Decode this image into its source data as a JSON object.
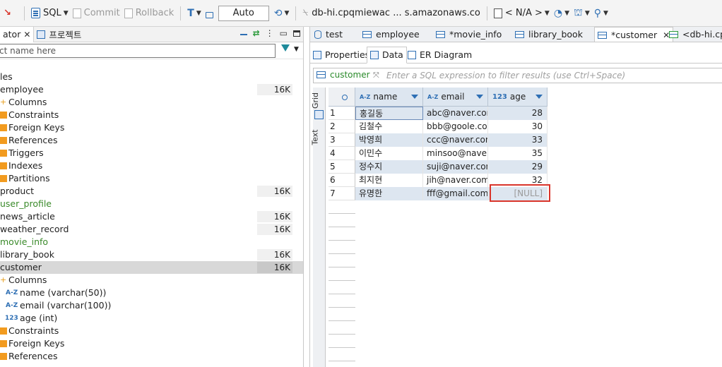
{
  "toolbar": {
    "sql_label": "SQL",
    "commit_label": "Commit",
    "rollback_label": "Rollback",
    "tx_mode": "Auto",
    "connection": "db-hi.cpqmiewac ... s.amazonaws.co",
    "schema": "< N/A >"
  },
  "left_panel": {
    "tab_navigator": "ator",
    "tab_project": "프로젝트",
    "filter_placeholder": "ct name here"
  },
  "tree": [
    {
      "label": "les",
      "indent": 0,
      "icon": "",
      "size": ""
    },
    {
      "label": "employee",
      "indent": 0,
      "icon": "",
      "size": "16K"
    },
    {
      "label": "Columns",
      "indent": 1,
      "icon": "plus",
      "size": ""
    },
    {
      "label": "Constraints",
      "indent": 1,
      "icon": "orange",
      "size": ""
    },
    {
      "label": "Foreign Keys",
      "indent": 1,
      "icon": "orange",
      "size": ""
    },
    {
      "label": "References",
      "indent": 1,
      "icon": "orange",
      "size": ""
    },
    {
      "label": "Triggers",
      "indent": 1,
      "icon": "orange",
      "size": ""
    },
    {
      "label": "Indexes",
      "indent": 1,
      "icon": "orange",
      "size": ""
    },
    {
      "label": "Partitions",
      "indent": 1,
      "icon": "orange",
      "size": ""
    },
    {
      "label": "product",
      "indent": 0,
      "icon": "",
      "size": "16K"
    },
    {
      "label": "user_profile",
      "indent": 0,
      "icon": "",
      "size": "",
      "green": true
    },
    {
      "label": "news_article",
      "indent": 0,
      "icon": "",
      "size": "16K"
    },
    {
      "label": "weather_record",
      "indent": 0,
      "icon": "",
      "size": "16K"
    },
    {
      "label": "movie_info",
      "indent": 0,
      "icon": "",
      "size": "",
      "green": true
    },
    {
      "label": "library_book",
      "indent": 0,
      "icon": "",
      "size": "16K"
    },
    {
      "label": "customer",
      "indent": 0,
      "icon": "",
      "size": "16K",
      "selected": true
    },
    {
      "label": "Columns",
      "indent": 1,
      "icon": "plus",
      "size": ""
    },
    {
      "label": "name (varchar(50))",
      "indent": 2,
      "icon": "az",
      "size": ""
    },
    {
      "label": "email (varchar(100))",
      "indent": 2,
      "icon": "az",
      "size": ""
    },
    {
      "label": "age (int)",
      "indent": 2,
      "icon": "n123",
      "size": ""
    },
    {
      "label": "Constraints",
      "indent": 1,
      "icon": "orange",
      "size": ""
    },
    {
      "label": "Foreign Keys",
      "indent": 1,
      "icon": "orange",
      "size": ""
    },
    {
      "label": "References",
      "indent": 1,
      "icon": "orange",
      "size": ""
    }
  ],
  "editor_tabs": [
    {
      "label": "test",
      "icon": "cyl"
    },
    {
      "label": "employee",
      "icon": "table"
    },
    {
      "label": "*movie_info",
      "icon": "table"
    },
    {
      "label": "library_book",
      "icon": "table"
    },
    {
      "label": "*customer",
      "icon": "table",
      "active": true
    },
    {
      "label": "<db-hi.cp",
      "icon": "sql"
    }
  ],
  "sub_tabs": {
    "properties": "Properties",
    "data": "Data",
    "er_diagram": "ER Diagram"
  },
  "filter_bar": {
    "table_name": "customer",
    "placeholder": "Enter a SQL expression to filter results (use Ctrl+Space)"
  },
  "side_tabs": {
    "grid": "Grid",
    "text": "Text"
  },
  "grid": {
    "type_badges": [
      "A-Z",
      "A-Z",
      "123"
    ],
    "columns": [
      "name",
      "email",
      "age"
    ],
    "rows": [
      {
        "num": "1",
        "name": "홍길동",
        "email": "abc@naver.com",
        "age": "28"
      },
      {
        "num": "2",
        "name": "김철수",
        "email": "bbb@goole.com",
        "age": "30"
      },
      {
        "num": "3",
        "name": "박영희",
        "email": "ccc@naver.com",
        "age": "33"
      },
      {
        "num": "4",
        "name": "이민수",
        "email": "minsoo@naver.com",
        "age": "35"
      },
      {
        "num": "5",
        "name": "정수지",
        "email": "suji@naver.com",
        "age": "29"
      },
      {
        "num": "6",
        "name": "최지현",
        "email": "jih@naver.com",
        "age": "32"
      },
      {
        "num": "7",
        "name": "유명한",
        "email": "fff@gmail.com",
        "age": "[NULL]"
      }
    ]
  },
  "colors": {
    "accent": "#2e6fb4",
    "highlight": "#d9352b",
    "header_bg": "#dde6f0",
    "green_text": "#3a8a2a"
  }
}
